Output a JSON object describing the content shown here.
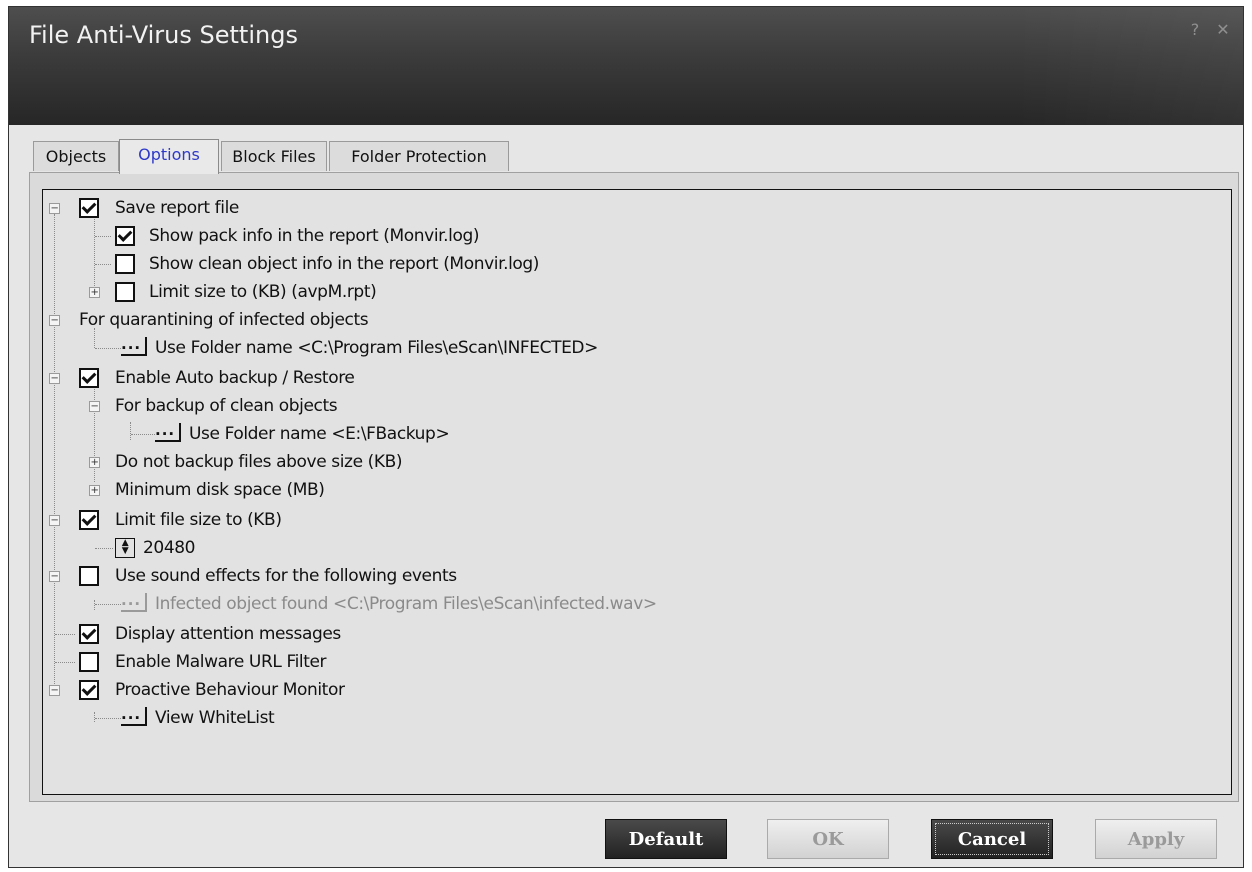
{
  "window": {
    "title": "File Anti-Virus Settings",
    "help_glyph": "?",
    "close_glyph": "✕"
  },
  "tabs": [
    {
      "label": "Objects",
      "active": false
    },
    {
      "label": "Options",
      "active": true
    },
    {
      "label": "Block Files",
      "active": false
    },
    {
      "label": "Folder Protection",
      "active": false
    }
  ],
  "tree": {
    "save_report": {
      "label": "Save report file",
      "checked": true
    },
    "show_pack": {
      "label": "Show pack info in the report (Monvir.log)",
      "checked": true
    },
    "show_clean": {
      "label": "Show clean object info in the report (Monvir.log)",
      "checked": false
    },
    "limit_report": {
      "label": "Limit size to (KB) (avpM.rpt)",
      "checked": false
    },
    "quarantine": {
      "label": "For quarantining of infected objects"
    },
    "quarantine_folder": {
      "label": "Use Folder name <C:\\Program Files\\eScan\\INFECTED>"
    },
    "auto_backup": {
      "label": "Enable Auto backup / Restore",
      "checked": true
    },
    "backup_clean": {
      "label": "For backup of clean objects"
    },
    "backup_folder": {
      "label": "Use Folder name <E:\\FBackup>"
    },
    "no_backup_above": {
      "label": "Do not backup files above size (KB)"
    },
    "min_disk": {
      "label": "Minimum disk space (MB)"
    },
    "limit_file": {
      "label": "Limit file size to (KB)",
      "checked": true
    },
    "limit_file_value": {
      "value": "20480"
    },
    "sound": {
      "label": "Use sound effects for the following events",
      "checked": false
    },
    "sound_infected": {
      "label": "Infected object found <C:\\Program Files\\eScan\\infected.wav>",
      "disabled": true
    },
    "attention": {
      "label": "Display attention messages",
      "checked": true
    },
    "malware_url": {
      "label": "Enable Malware URL Filter",
      "checked": false
    },
    "proactive": {
      "label": "Proactive Behaviour Monitor",
      "checked": true
    },
    "whitelist": {
      "label": "View WhiteList"
    }
  },
  "glyphs": {
    "ellipsis": "...",
    "minus": "−",
    "plus": "+"
  },
  "buttons": {
    "default": "Default",
    "ok": "OK",
    "cancel": "Cancel",
    "apply": "Apply"
  }
}
